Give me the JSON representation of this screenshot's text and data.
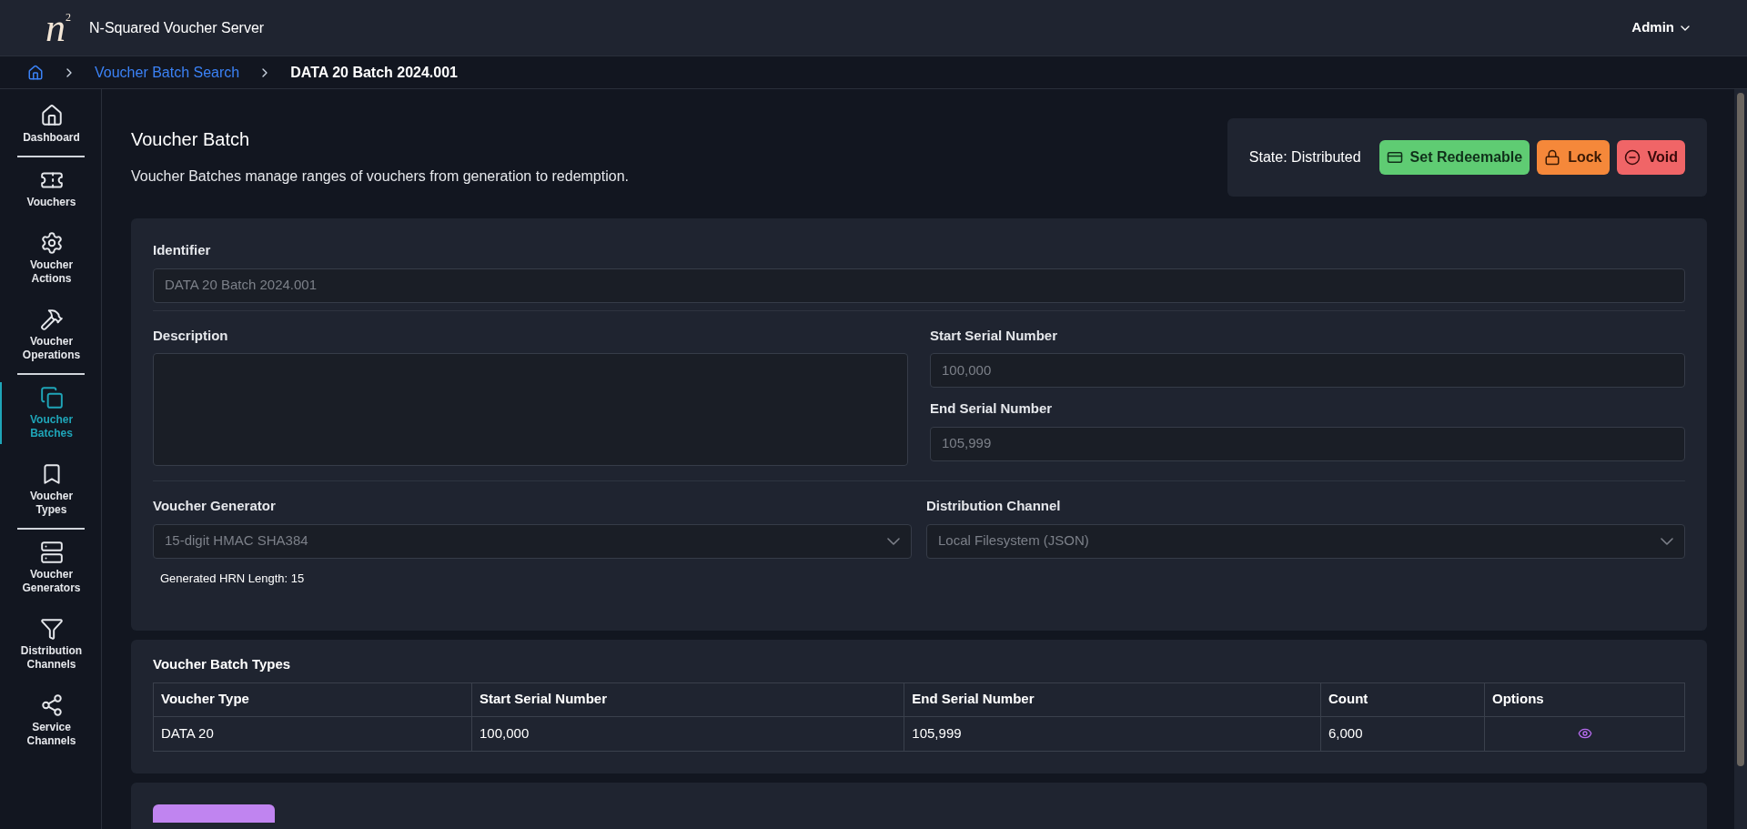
{
  "app": {
    "logo": "n",
    "logo_sup": "2",
    "title": "N-Squared Voucher Server",
    "user": "Admin"
  },
  "breadcrumb": [
    {
      "label": "Voucher Batch Search"
    },
    {
      "label": "DATA 20 Batch 2024.001"
    }
  ],
  "sidebar": {
    "groups": [
      [
        {
          "label": "Dashboard",
          "selected": false
        }
      ],
      [
        {
          "label": "Vouchers",
          "selected": false
        },
        {
          "label": "Voucher Actions",
          "selected": false
        },
        {
          "label": "Voucher Operations",
          "selected": false
        }
      ],
      [
        {
          "label": "Voucher Batches",
          "selected": true
        },
        {
          "label": "Voucher Types",
          "selected": false
        }
      ],
      [
        {
          "label": "Voucher Generators",
          "selected": false
        },
        {
          "label": "Distribution Channels",
          "selected": false
        },
        {
          "label": "Service Channels",
          "selected": false
        }
      ]
    ]
  },
  "header": {
    "title": "Voucher Batch",
    "description": "Voucher Batches manage ranges of vouchers from generation to redemption.",
    "state": "State: Distributed",
    "actions": [
      {
        "label": "Set Redeemable",
        "kind": "redeem"
      },
      {
        "label": "Lock",
        "kind": "lock"
      },
      {
        "label": "Void",
        "kind": "void"
      }
    ]
  },
  "form": {
    "identifier": {
      "label": "Identifier",
      "value": "DATA 20 Batch 2024.001",
      "disabled": true
    },
    "description": {
      "label": "Description"
    },
    "start_serial": {
      "label": "Start Serial Number",
      "value": "100,000",
      "disabled": true
    },
    "end_serial": {
      "label": "End Serial Number",
      "value": "105,999",
      "disabled": true
    },
    "generator": {
      "label": "Voucher Generator",
      "value": "15-digit HMAC SHA384",
      "hint": "Generated HRN Length: 15",
      "disabled": true
    },
    "channel": {
      "label": "Distribution Channel",
      "value": "Local Filesystem (JSON)",
      "disabled": true
    }
  },
  "batch_types": {
    "title": "Voucher Batch Types",
    "columns": [
      "Voucher Type",
      "Start Serial Number",
      "End Serial Number",
      "Count",
      "Options"
    ],
    "rows": [
      [
        "DATA 20",
        "100,000",
        "105,999",
        "6,000"
      ]
    ]
  }
}
